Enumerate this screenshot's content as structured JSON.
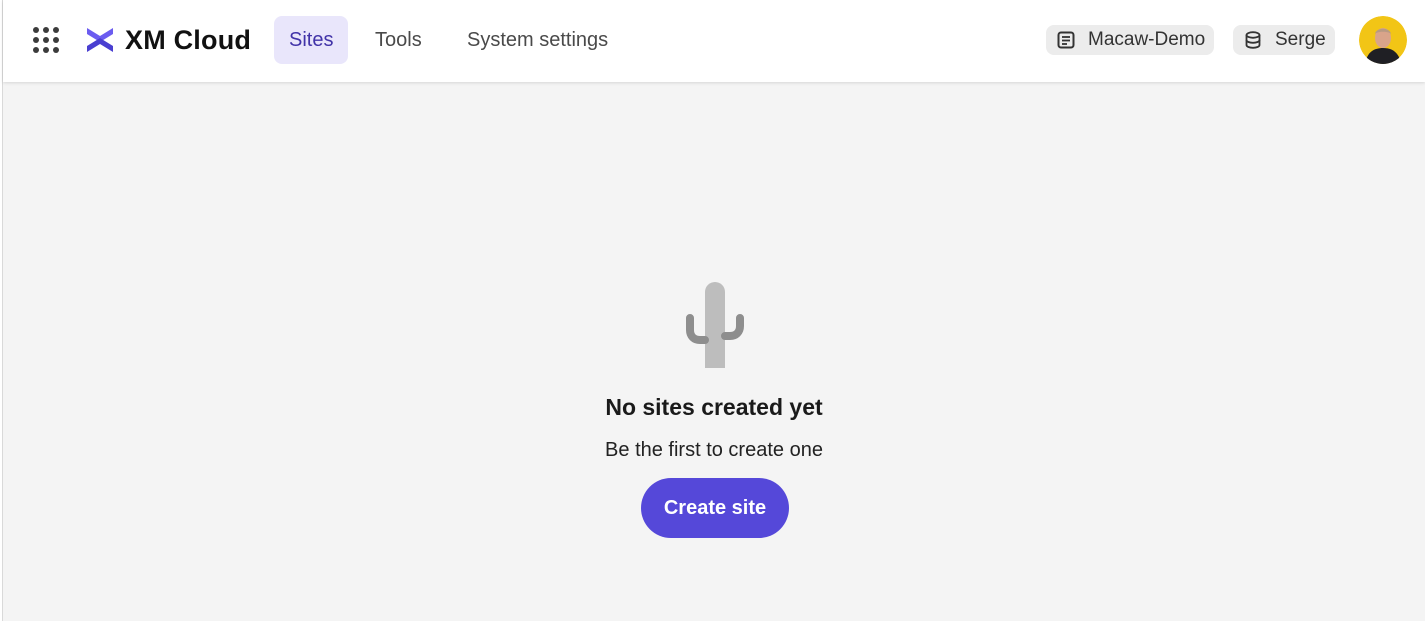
{
  "app": {
    "title": "XM Cloud",
    "accent_color": "#5548d9",
    "logo_icon": "xm-cloud-logo-icon",
    "launcher_icon": "app-grid-icon"
  },
  "nav": {
    "items": [
      {
        "label": "Sites",
        "active": true
      },
      {
        "label": "Tools",
        "active": false
      },
      {
        "label": "System settings",
        "active": false
      }
    ]
  },
  "context": {
    "project": {
      "label": "Macaw-Demo",
      "icon": "project-icon"
    },
    "environment": {
      "label": "Serge",
      "icon": "database-icon"
    }
  },
  "user": {
    "avatar_icon": "user-avatar"
  },
  "empty_state": {
    "icon": "cactus-icon",
    "title": "No sites created yet",
    "subtitle": "Be the first to create one",
    "action_label": "Create site"
  }
}
